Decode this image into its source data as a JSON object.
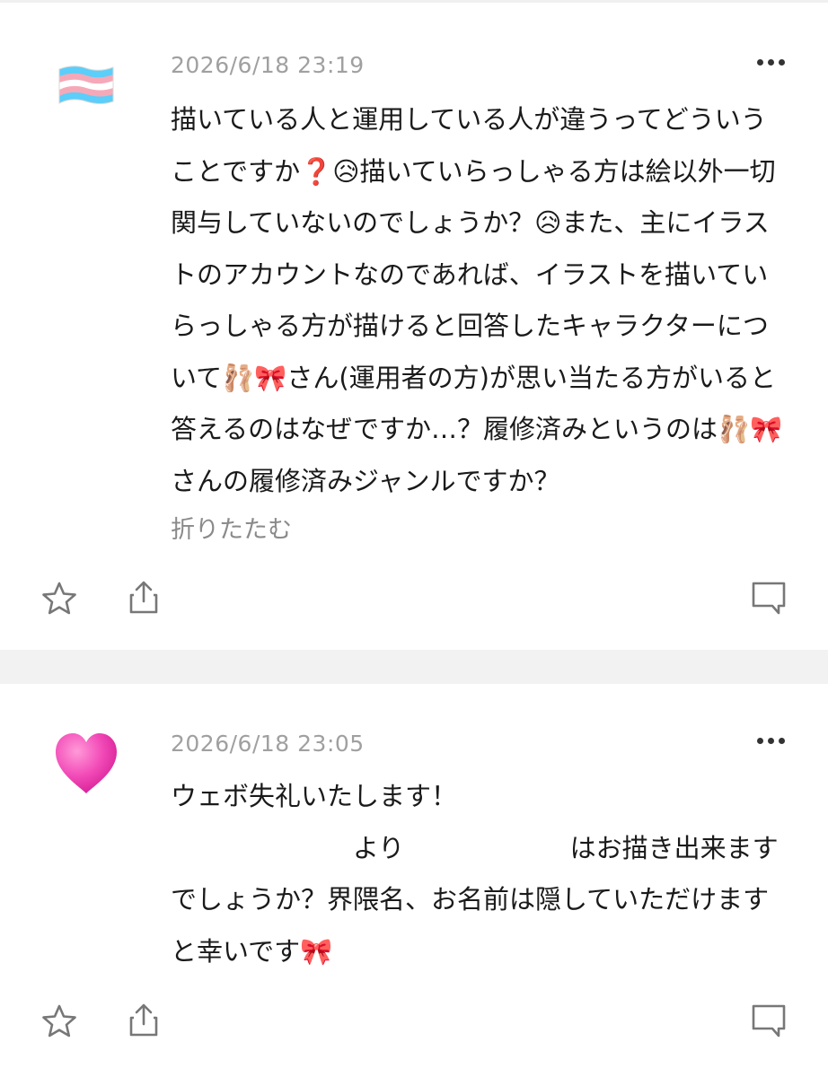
{
  "comments": [
    {
      "avatar": "transgender-flag-emoji",
      "timestamp": "2026/6/18 23:19",
      "text": "描いている人と運用している人が違うってどういうことですか❓😥描いていらっしゃる方は絵以外一切関与していないのでしょうか？😥また、主にイラストのアカウントなのであれば、イラストを描いていらっしゃる方が描けると回答したキャラクターについて🩰🎀さん(運用者の方)が思い当たる方がいると答えるのはなぜですか…？履修済みというのは🩰🎀さんの履修済みジャンルですか？",
      "collapse_label": "折りたたむ"
    },
    {
      "avatar": "pink-heart-emoji",
      "timestamp": "2026/6/18 23:05",
      "text": "ウェボ失礼いたします！\n                      より                    はお描き出来ますでしょうか？界隈名、お名前は隠していただけますと幸いです🎀"
    }
  ],
  "icons": {
    "more": "more-dots-icon",
    "favorite": "star-icon",
    "share": "share-icon",
    "reply": "comment-icon"
  },
  "colors": {
    "timestamp": "#a0a0a0",
    "text": "#1a1a1a",
    "divider": "#f2f2f2",
    "icon": "#777777"
  }
}
